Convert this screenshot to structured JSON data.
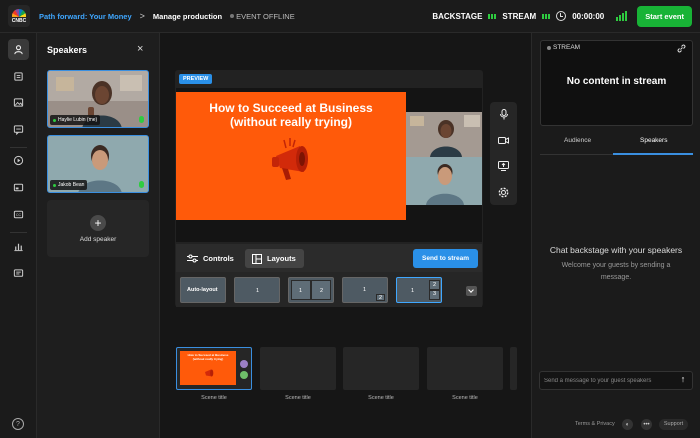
{
  "header": {
    "logo_text": "CNBC",
    "breadcrumb_program": "Path forward: Your Money",
    "breadcrumb_sep": ">",
    "breadcrumb_page": "Manage production",
    "event_status": "EVENT OFFLINE",
    "backstage_label": "BACKSTAGE",
    "stream_label": "STREAM",
    "timer": "00:00:00",
    "start_button": "Start event"
  },
  "rail": {
    "items": [
      "person-icon",
      "layers-icon",
      "image-icon",
      "caption-icon",
      "play-icon",
      "screen-icon",
      "cc-icon",
      "stats-icon",
      "chat-icon"
    ],
    "help": "?"
  },
  "speakers_panel": {
    "title": "Speakers",
    "close": "×",
    "speakers": [
      {
        "name": "Haylie Lubin (me)",
        "mic": "on"
      },
      {
        "name": "Jakob Bean",
        "mic": "on"
      }
    ],
    "add_label": "Add speaker",
    "add_symbol": "+"
  },
  "stage": {
    "preview_badge": "PREVIEW",
    "slide_title_line1": "How to Succeed at Business",
    "slide_title_line2": "(without really trying)",
    "controls_label": "Controls",
    "layouts_label": "Layouts",
    "send_button": "Send to stream",
    "layouts": [
      {
        "label": "Auto-layout"
      },
      {
        "label": "1"
      },
      {
        "label_a": "1",
        "label_b": "2"
      },
      {
        "label_a": "1",
        "label_b": "2"
      },
      {
        "label_a": "1",
        "label_b": "2",
        "label_c": "3"
      }
    ],
    "side_tools": [
      "mic-icon",
      "camera-icon",
      "share-screen-icon",
      "settings-icon"
    ]
  },
  "scenes": {
    "items": [
      {
        "label": "Scene title",
        "thumb_line1": "How to Succeed at Business",
        "thumb_line2": "(without really trying)"
      },
      {
        "label": "Scene title"
      },
      {
        "label": "Scene title"
      },
      {
        "label": "Scene title"
      }
    ]
  },
  "right_panel": {
    "stream_label": "STREAM",
    "no_content": "No content in stream",
    "tabs": [
      "Audience",
      "Speakers"
    ],
    "active_tab": "Speakers",
    "chat_title": "Chat backstage with your speakers",
    "chat_subtitle": "Welcome your guests by sending a message.",
    "message_placeholder": "Send a message to your guest speakers",
    "terms": "Terms & Privacy",
    "support": "Support"
  },
  "colors": {
    "accent_blue": "#2a90e8",
    "live_green": "#18b336",
    "slide_orange": "#ff5a0a"
  }
}
